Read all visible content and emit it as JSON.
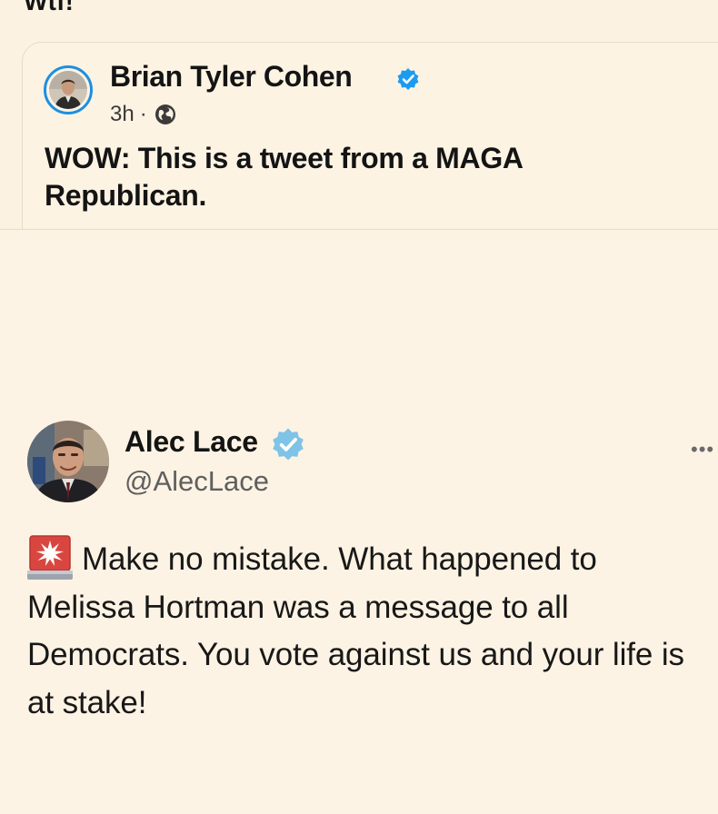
{
  "post": {
    "caption": "Wtf!"
  },
  "quoted_post": {
    "author_name": "Brian Tyler Cohen",
    "time": "3h",
    "separator": "·",
    "text": "WOW: This is a tweet from a MAGA Republican.",
    "verified_color": "#1d9bf0"
  },
  "embedded_tweet": {
    "author_name": "Alec Lace",
    "handle": "@AlecLace",
    "text": "Make no mistake.  What happened to Melissa Hortman was a message to all Democrats.  You vote against us and your life is at stake!",
    "leading_emoji": "rotating-light-icon",
    "verified_color": "#7fc3e6"
  },
  "colors": {
    "background": "#fcf2e2",
    "text": "#141414",
    "muted": "#5f5f5f",
    "accent": "#1d8fe0"
  }
}
